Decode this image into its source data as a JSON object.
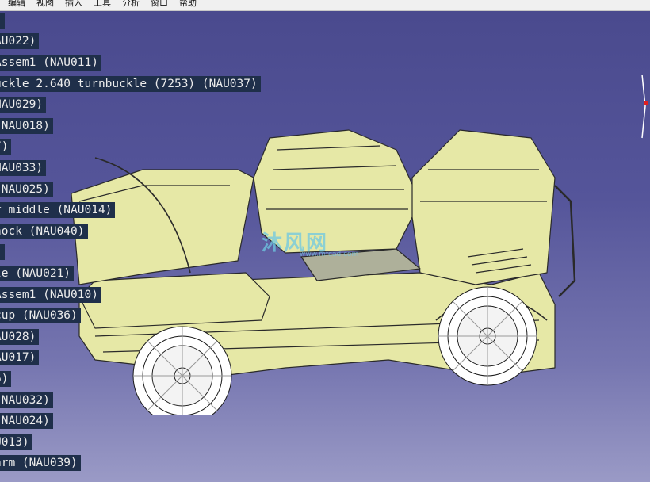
{
  "menu": [
    "编辑",
    "视图",
    "插入",
    "工具",
    "分析",
    "窗口",
    "帮助"
  ],
  "tree": [
    ")",
    "AU022)",
    "Assem1 (NAU011)",
    "uckle_2.640 turnbuckle (7253) (NAU037)",
    "NAU029)",
    "(NAU018)",
    "7)",
    "NAU033)",
    " (NAU025)",
    "r middle (NAU014)",
    "hock (NAU040)",
    ")",
    "le (NAU021)",
    "Assem1 (NAU010)",
    "cup (NAU036)",
    "AU028)",
    "AU017)",
    "6)",
    "(NAU032)",
    "(NAU024)",
    "U013)",
    "arm (NAU039)"
  ],
  "watermark": {
    "logo_text": "沐风网",
    "url": "www.mfcad.com"
  },
  "colors": {
    "body": "#e6e8a6",
    "background_top": "#4a4a8e",
    "background_bottom": "#9a9ac6",
    "tree_label_bg": "#1f2f4a"
  },
  "icons": [
    "compass-icon"
  ]
}
